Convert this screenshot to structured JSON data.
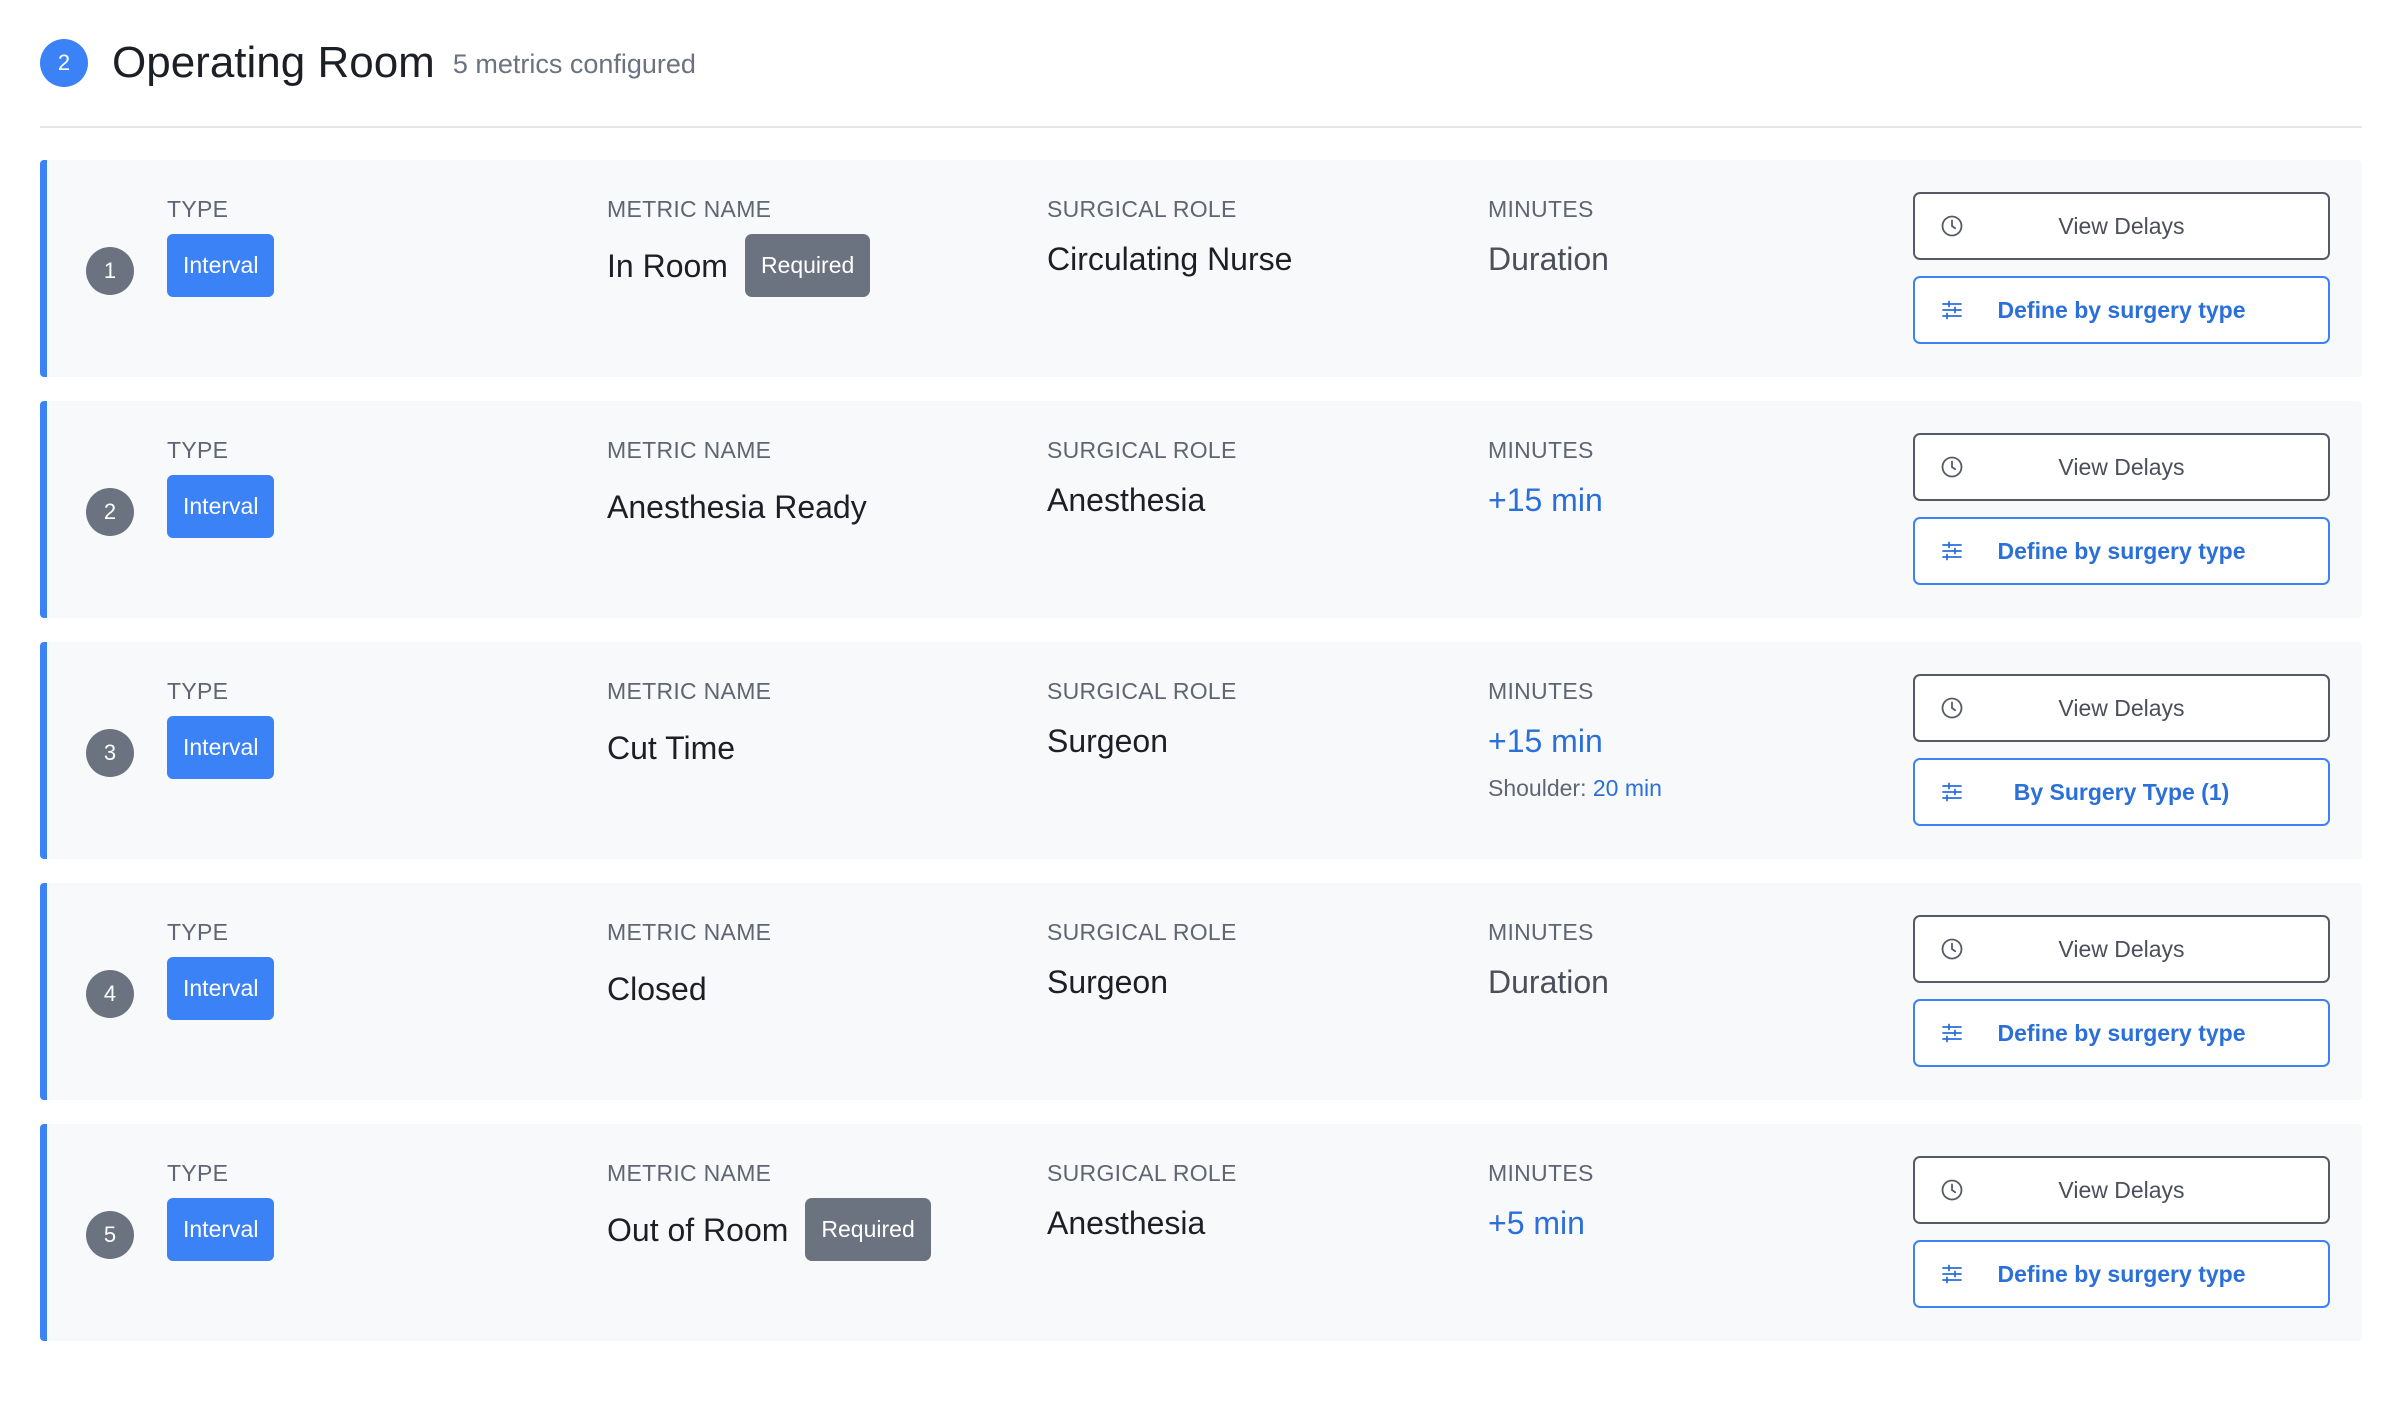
{
  "header": {
    "step_number": "2",
    "title": "Operating Room",
    "subtitle": "5 metrics configured"
  },
  "labels": {
    "type": "TYPE",
    "metric_name": "METRIC NAME",
    "surgical_role": "SURGICAL ROLE",
    "minutes": "MINUTES",
    "required": "Required",
    "view_delays": "View Delays"
  },
  "colors": {
    "accent": "#3b82f6",
    "badge_gray": "#6b7280",
    "link_blue": "#2b6fd9"
  },
  "metrics": [
    {
      "number": "1",
      "type": "Interval",
      "name": "In Room",
      "required": true,
      "role": "Circulating Nurse",
      "minutes": "Duration",
      "minutes_style": "dark",
      "override_label": "",
      "override_value": "",
      "define_label": "Define by surgery type"
    },
    {
      "number": "2",
      "type": "Interval",
      "name": "Anesthesia Ready",
      "required": false,
      "role": "Anesthesia",
      "minutes": "+15 min",
      "minutes_style": "blue",
      "override_label": "",
      "override_value": "",
      "define_label": "Define by surgery type"
    },
    {
      "number": "3",
      "type": "Interval",
      "name": "Cut Time",
      "required": false,
      "role": "Surgeon",
      "minutes": "+15 min",
      "minutes_style": "blue",
      "override_label": "Shoulder:",
      "override_value": "20 min",
      "define_label": "By Surgery Type (1)"
    },
    {
      "number": "4",
      "type": "Interval",
      "name": "Closed",
      "required": false,
      "role": "Surgeon",
      "minutes": "Duration",
      "minutes_style": "dark",
      "override_label": "",
      "override_value": "",
      "define_label": "Define by surgery type"
    },
    {
      "number": "5",
      "type": "Interval",
      "name": "Out of Room",
      "required": true,
      "role": "Anesthesia",
      "minutes": "+5 min",
      "minutes_style": "blue",
      "override_label": "",
      "override_value": "",
      "define_label": "Define by surgery type"
    }
  ]
}
